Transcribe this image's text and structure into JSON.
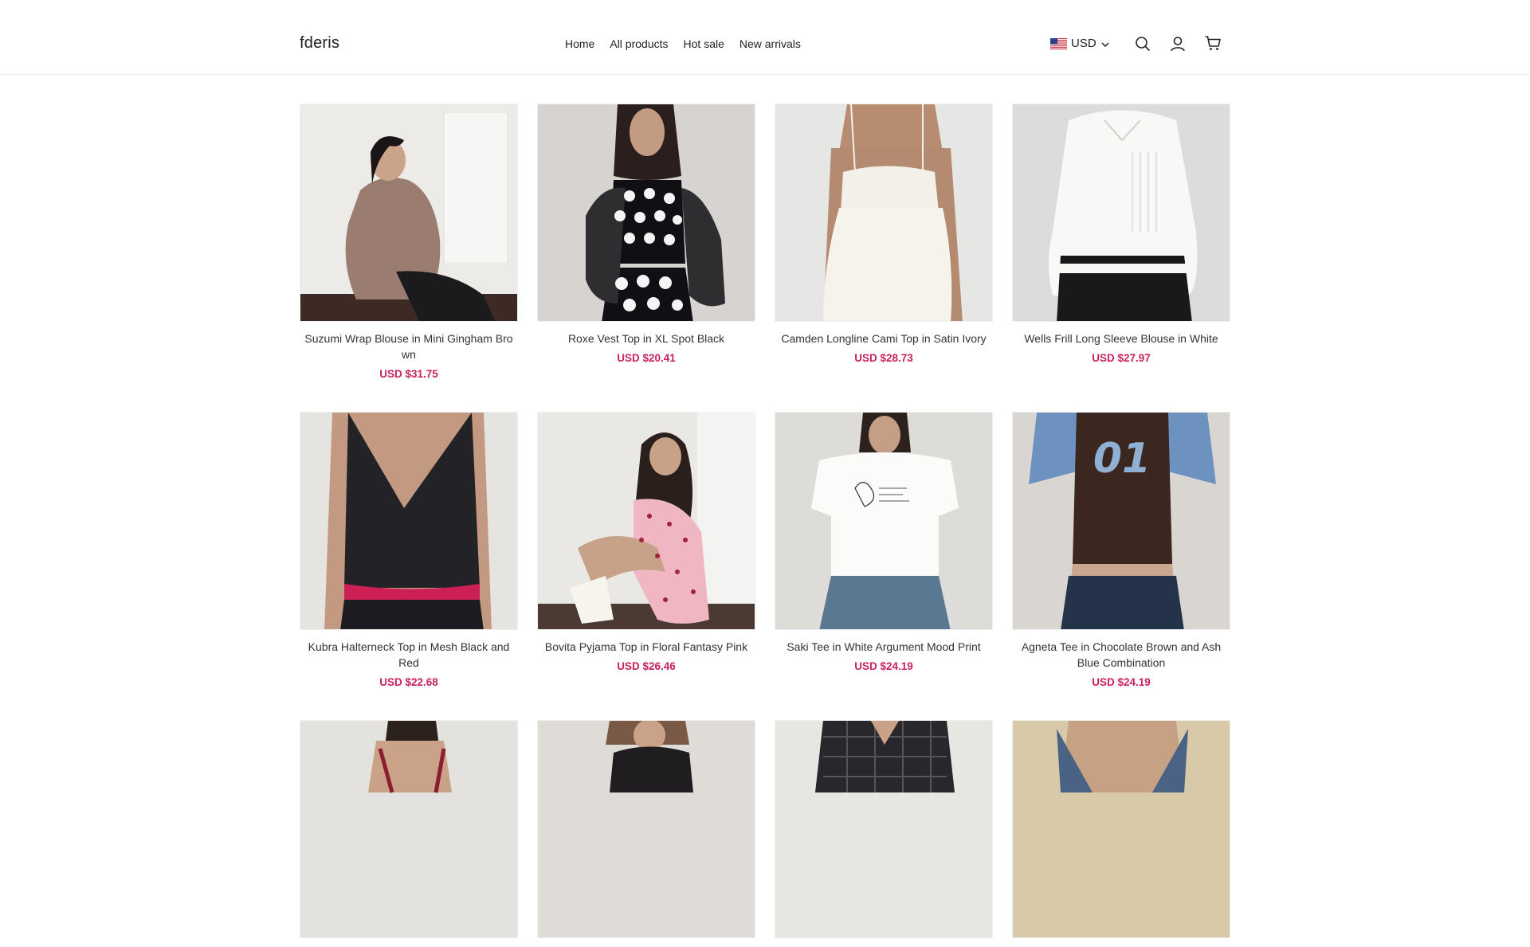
{
  "header": {
    "logo": "fderis",
    "nav": [
      "Home",
      "All products",
      "Hot sale",
      "New arrivals"
    ],
    "currency": "USD",
    "icons": [
      "search-icon",
      "account-icon",
      "cart-icon"
    ]
  },
  "products": [
    {
      "title": "Suzumi Wrap Blouse in Mini Gingham Brown",
      "price": "USD $31.75"
    },
    {
      "title": "Roxe Vest Top in XL Spot Black",
      "price": "USD $20.41"
    },
    {
      "title": "Camden Longline Cami Top in Satin Ivory",
      "price": "USD $28.73"
    },
    {
      "title": "Wells Frill Long Sleeve Blouse in White",
      "price": "USD $27.97"
    },
    {
      "title": "Kubra Halterneck Top in Mesh Black and Red",
      "price": "USD $22.68"
    },
    {
      "title": "Bovita Pyjama Top in Floral Fantasy Pink",
      "price": "USD $26.46"
    },
    {
      "title": "Saki Tee in White Argument Mood Print",
      "price": "USD $24.19"
    },
    {
      "title": "Agneta Tee in Chocolate Brown and Ash Blue Combination",
      "price": "USD $24.19"
    },
    {
      "title": "",
      "price": ""
    },
    {
      "title": "",
      "price": ""
    },
    {
      "title": "",
      "price": ""
    },
    {
      "title": "",
      "price": ""
    }
  ],
  "colors": {
    "price": "#c9215d",
    "text": "#222222",
    "border": "#ececec"
  }
}
